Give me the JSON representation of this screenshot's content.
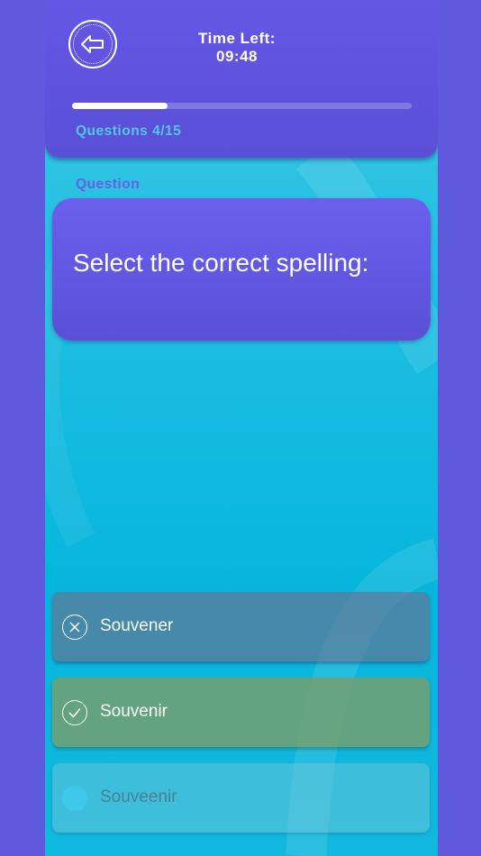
{
  "header": {
    "back_icon": "back-arrow-icon",
    "timer_label": "Time Left:",
    "timer_value": "09:48",
    "progress_fraction": 0.28,
    "questions_count": "Questions 4/15"
  },
  "question": {
    "label": "Question",
    "text": "Select the correct spelling:"
  },
  "options": [
    {
      "label": "Souvener",
      "state": "wrong",
      "icon": "x-circle-icon"
    },
    {
      "label": "Souvenir",
      "state": "correct",
      "icon": "check-circle-icon"
    },
    {
      "label": "Souveenir",
      "state": "unanswered",
      "icon": "circle-dot-icon"
    }
  ],
  "colors": {
    "page_background": "#5f59dd",
    "header_purple": "#5a4fd6",
    "screen_cyan": "#06b5dc",
    "accent_label": "#4fc7f0"
  }
}
